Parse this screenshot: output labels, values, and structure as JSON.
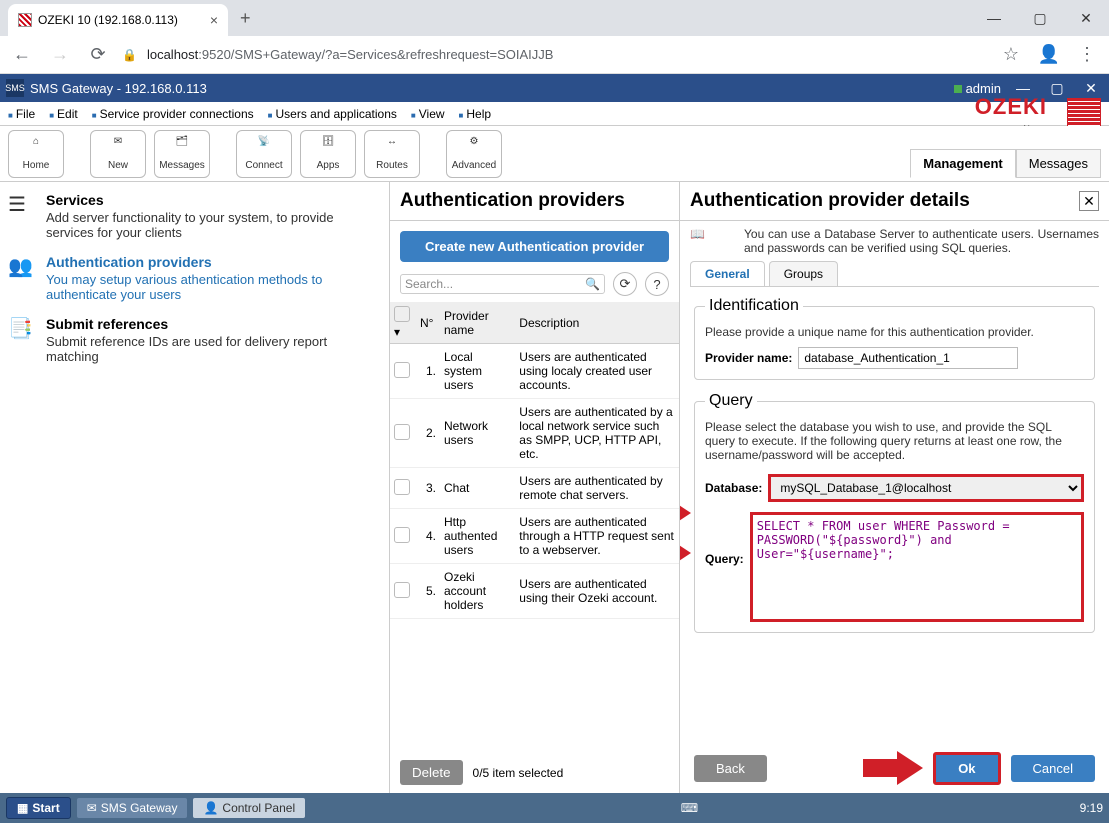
{
  "browser": {
    "tab_title": "OZEKI 10 (192.168.0.113)",
    "url_host": "localhost",
    "url_port_path": ":9520/SMS+Gateway/?a=Services&refreshrequest=SOIAIJJB"
  },
  "app": {
    "titlebar": "SMS Gateway - 192.168.0.113",
    "user": "admin"
  },
  "menu": {
    "file": "File",
    "edit": "Edit",
    "spc": "Service provider connections",
    "ua": "Users and applications",
    "view": "View",
    "help": "Help",
    "logo_text": "OZEKI",
    "logo_url": "www.myozeki.com"
  },
  "toolbar": {
    "home": "Home",
    "new": "New",
    "messages": "Messages",
    "connect": "Connect",
    "apps": "Apps",
    "routes": "Routes",
    "advanced": "Advanced",
    "tab_management": "Management",
    "tab_messages": "Messages"
  },
  "sidebar": {
    "services_title": "Services",
    "services_desc": "Add server functionality to your system, to provide services for your clients",
    "auth_title": "Authentication providers",
    "auth_desc": "You may setup various athentication methods to authenticate your users",
    "submit_title": "Submit references",
    "submit_desc": "Submit reference IDs are used for delivery report matching"
  },
  "middle": {
    "header": "Authentication providers",
    "create_btn": "Create new Authentication provider",
    "search_placeholder": "Search...",
    "col_num": "N°",
    "col_name": "Provider name",
    "col_desc": "Description",
    "rows": [
      {
        "n": "1.",
        "name": "Local system users",
        "desc": "Users are authenticated using localy created user accounts."
      },
      {
        "n": "2.",
        "name": "Network users",
        "desc": "Users are authenticated by a local network service such as SMPP, UCP, HTTP API, etc."
      },
      {
        "n": "3.",
        "name": "Chat",
        "desc": "Users are authenticated by remote chat servers."
      },
      {
        "n": "4.",
        "name": "Http authented users",
        "desc": "Users are authenticated through a HTTP request sent to a webserver."
      },
      {
        "n": "5.",
        "name": "Ozeki account holders",
        "desc": "Users are authenticated using their Ozeki account."
      }
    ],
    "delete": "Delete",
    "selected": "0/5 item selected"
  },
  "details": {
    "header": "Authentication provider details",
    "intro": "You can use a Database Server to authenticate users. Usernames and passwords can be verified using SQL queries.",
    "tab_general": "General",
    "tab_groups": "Groups",
    "ident_legend": "Identification",
    "ident_help": "Please provide a unique name for this authentication provider.",
    "provider_label": "Provider name:",
    "provider_value": "database_Authentication_1",
    "query_legend": "Query",
    "query_help": "Please select the database you wish to use, and provide the SQL query to execute. If the following query returns at least one row, the username/password will be accepted.",
    "db_label": "Database:",
    "db_value": "mySQL_Database_1@localhost",
    "query_label": "Query:",
    "query_value": "SELECT * FROM user WHERE Password = PASSWORD(\"${password}\") and User=\"${username}\";",
    "back": "Back",
    "ok": "Ok",
    "cancel": "Cancel"
  },
  "taskbar": {
    "start": "Start",
    "sms": "SMS Gateway",
    "cp": "Control Panel",
    "time": "9:19"
  }
}
